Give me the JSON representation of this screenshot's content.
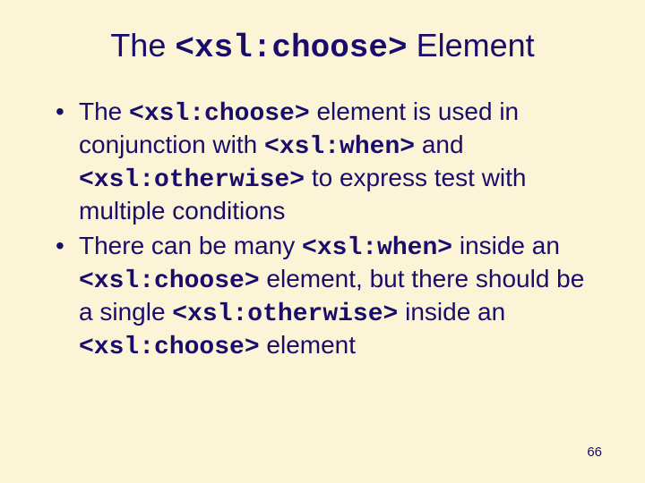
{
  "title": {
    "pre": "The ",
    "code": "<xsl:choose>",
    "post": " Element"
  },
  "bullets": [
    {
      "t1": "The ",
      "c1": "<xsl:choose>",
      "t2": " element is used in conjunction with ",
      "c2": "<xsl:when>",
      "t3": " and ",
      "c3": "<xsl:otherwise>",
      "t4": " to express test with multiple conditions"
    },
    {
      "t1": "There can be many ",
      "c1": "<xsl:when>",
      "t2": " inside an ",
      "c2": "<xsl:choose>",
      "t3": " element, but there should be a single ",
      "c3": "<xsl:otherwise>",
      "t4": " inside an ",
      "c4": "<xsl:choose>",
      "t5": " element"
    }
  ],
  "page_number": "66"
}
